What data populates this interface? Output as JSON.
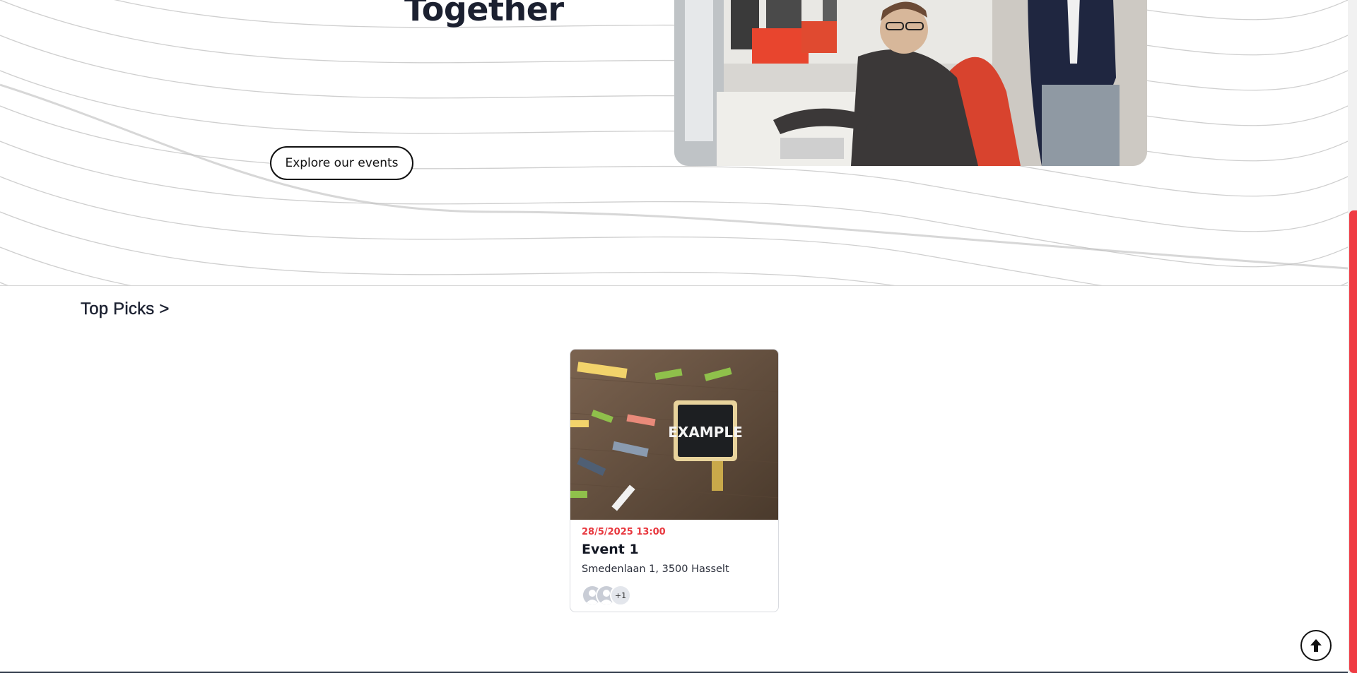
{
  "hero": {
    "title": "Together",
    "explore_label": "Explore our events"
  },
  "top_picks": {
    "title": "Top Picks >",
    "events": [
      {
        "date": "28/5/2025 13:00",
        "title": "Event 1",
        "address": "Smedenlaan 1, 3500 Hasselt",
        "image_sign_text": "EXAMPLE",
        "attendees_more": "+1"
      }
    ]
  },
  "colors": {
    "accent": "#e8383f",
    "scrollbar": "#ef3b43",
    "text": "#1b2030"
  },
  "icons": {
    "scroll_top": "arrow-up-circle-icon"
  }
}
